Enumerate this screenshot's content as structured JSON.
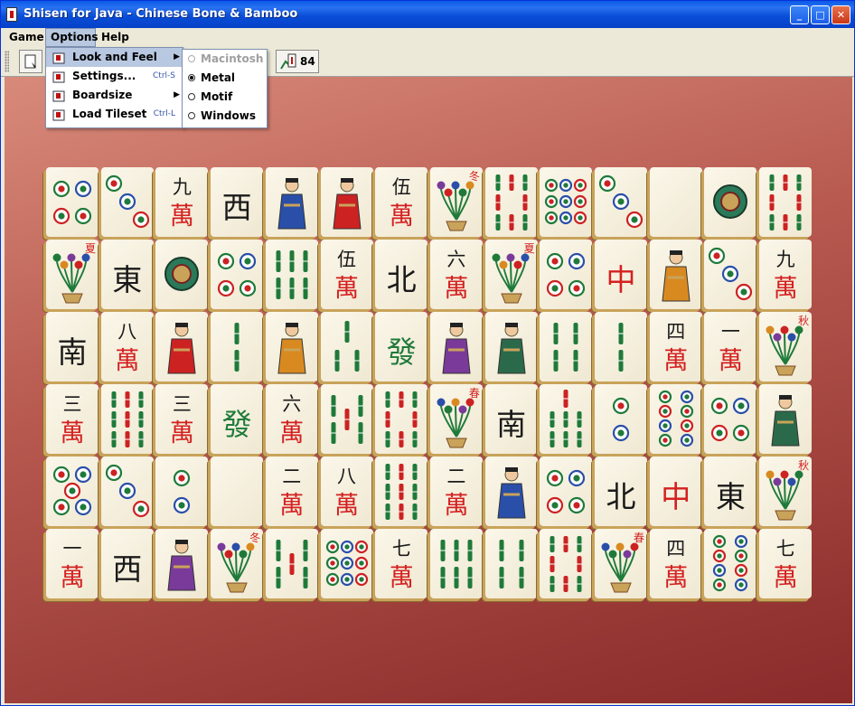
{
  "window": {
    "title": "Shisen for Java - Chinese Bone & Bamboo",
    "min": "_",
    "max": "□",
    "close": "✕"
  },
  "menu": {
    "game": "Game",
    "options": "Options",
    "help": "Help"
  },
  "toolbar": {
    "tiles_left": "84"
  },
  "options_menu": [
    {
      "label": "Look and Feel",
      "accel": "",
      "submenu": true,
      "icon": "look-and-feel-icon"
    },
    {
      "label": "Settings...",
      "accel": "Ctrl-S",
      "submenu": false,
      "icon": "settings-icon"
    },
    {
      "label": "Boardsize",
      "accel": "",
      "submenu": true,
      "icon": "boardsize-icon"
    },
    {
      "label": "Load Tileset",
      "accel": "Ctrl-L",
      "submenu": false,
      "icon": "tileset-icon"
    }
  ],
  "lookfeel_menu": [
    {
      "label": "Macintosh",
      "selected": false,
      "enabled": false
    },
    {
      "label": "Metal",
      "selected": true,
      "enabled": true
    },
    {
      "label": "Motif",
      "selected": false,
      "enabled": true
    },
    {
      "label": "Windows",
      "selected": false,
      "enabled": true
    }
  ],
  "tiles": [
    [
      "c4",
      "c3",
      "w9",
      "西",
      "f2",
      "f1",
      "w5",
      "s4",
      "b8",
      "c9",
      "c3",
      "",
      "c1",
      "b8"
    ],
    [
      "s2",
      "東",
      "c1",
      "c4",
      "b6",
      "w5",
      "北",
      "w6",
      "s2",
      "c4",
      "中",
      "f3",
      "c3",
      "w9"
    ],
    [
      "南",
      "w8",
      "f1",
      "b2",
      "f3",
      "b3",
      "發",
      "f4",
      "f5",
      "b4",
      "b2",
      "w4",
      "w1",
      "s3"
    ],
    [
      "w3",
      "b9",
      "w3",
      "發",
      "w6",
      "b5",
      "b8",
      "s1",
      "南",
      "b7",
      "c2",
      "c8",
      "c4",
      "f5"
    ],
    [
      "c5",
      "c3",
      "c2",
      "",
      "w2",
      "w8",
      "b9",
      "w2",
      "f2",
      "c4",
      "北",
      "中",
      "東",
      "s3"
    ],
    [
      "w1",
      "西",
      "f4",
      "s4",
      "b5",
      "c9",
      "w7",
      "b6",
      "b4",
      "b8",
      "s1",
      "w4",
      "c8",
      "w7"
    ]
  ],
  "glyphs": {
    "w1": "一",
    "w2": "二",
    "w3": "三",
    "w4": "四",
    "w5": "伍",
    "w6": "六",
    "w7": "七",
    "w8": "八",
    "w9": "九",
    "wan": "萬",
    "s1": "春",
    "s2": "夏",
    "s3": "秋",
    "s4": "冬"
  },
  "colors": {
    "accent": "#0a4fd8",
    "background_top": "#d88a7a",
    "background_bottom": "#8a2a2a"
  }
}
